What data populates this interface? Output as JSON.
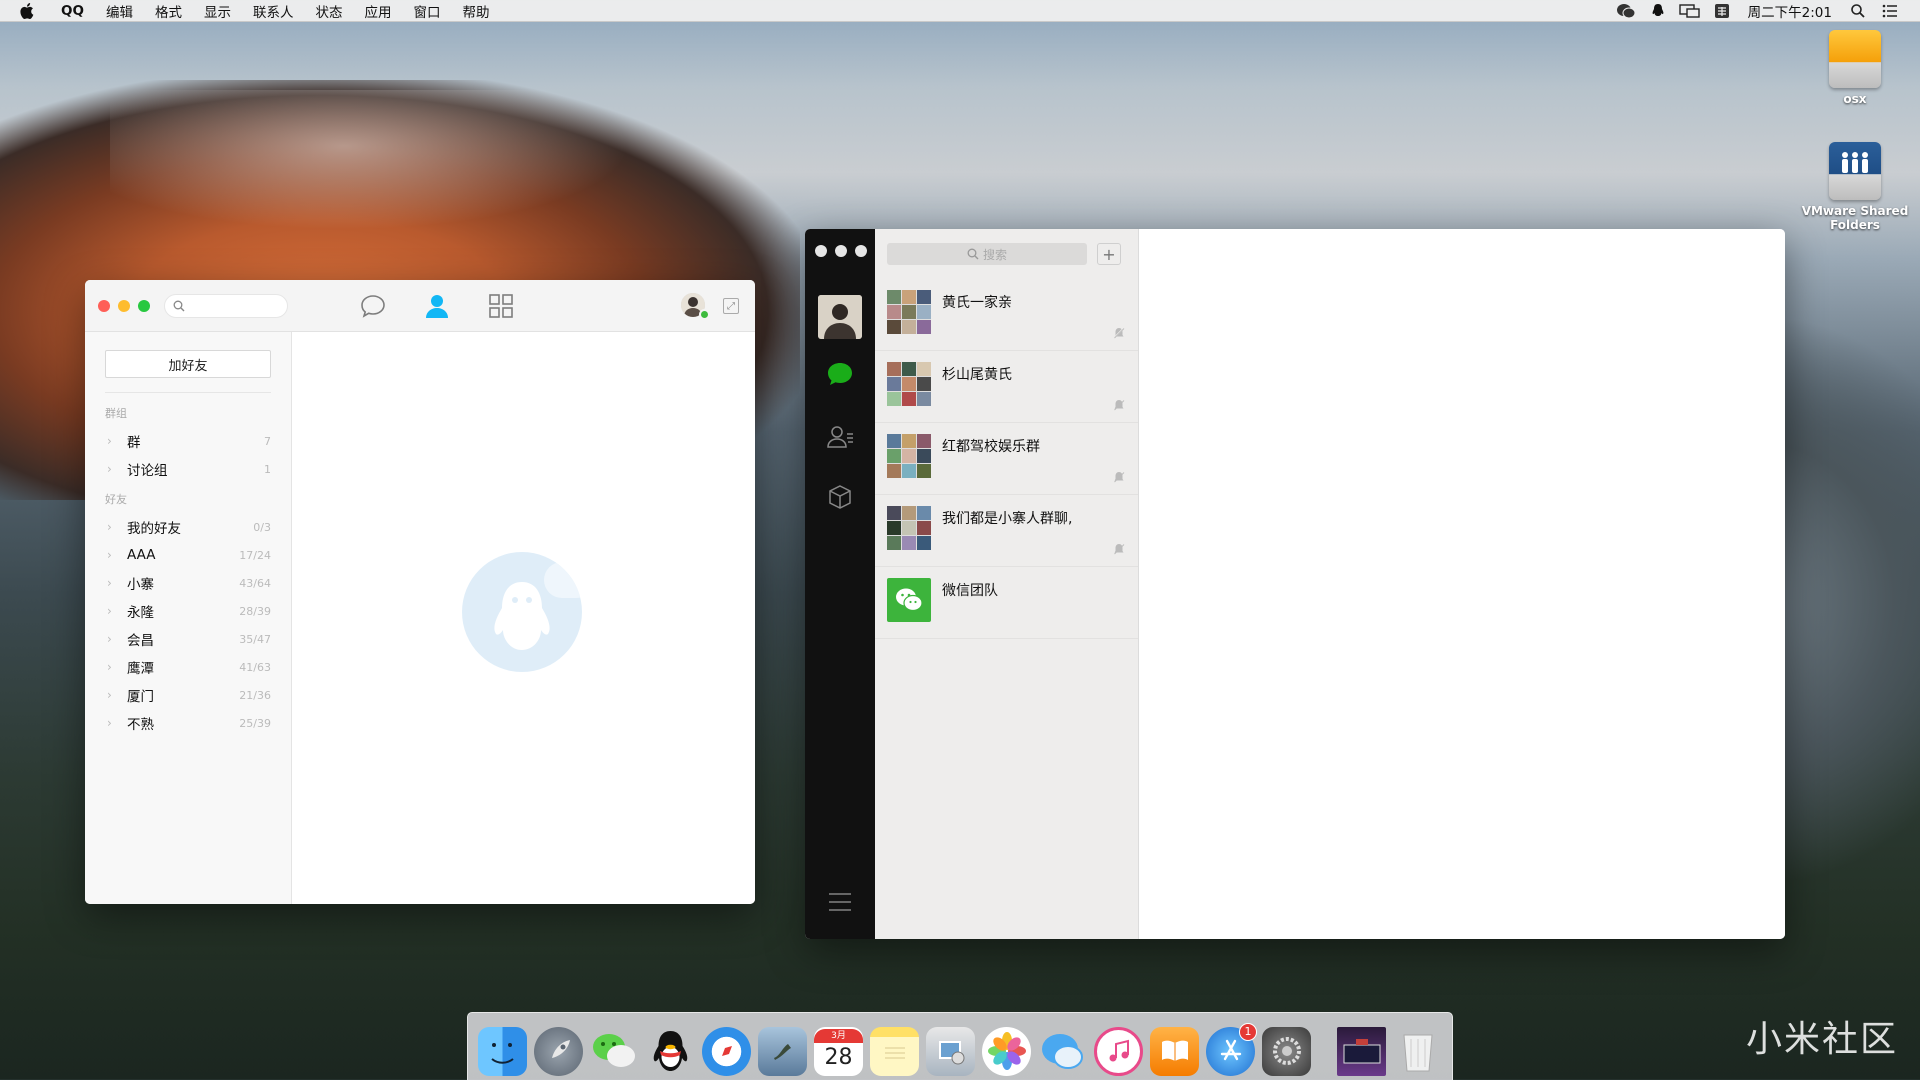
{
  "menubar": {
    "app_name": "QQ",
    "items": [
      "编辑",
      "格式",
      "显示",
      "联系人",
      "状态",
      "应用",
      "窗口",
      "帮助"
    ],
    "clock": "周二下午2:01"
  },
  "desktop": {
    "icons": [
      {
        "label": "osx"
      },
      {
        "label": "VMware Shared Folders"
      }
    ]
  },
  "qq": {
    "search_placeholder": "",
    "add_friend": "加好友",
    "section_groups": "群组",
    "groups": [
      {
        "name": "群",
        "count": "7"
      },
      {
        "name": "讨论组",
        "count": "1"
      }
    ],
    "section_friends": "好友",
    "friends": [
      {
        "name": "我的好友",
        "count": "0/3"
      },
      {
        "name": "AAA",
        "count": "17/24"
      },
      {
        "name": "小寨",
        "count": "43/64"
      },
      {
        "name": "永隆",
        "count": "28/39"
      },
      {
        "name": "会昌",
        "count": "35/47"
      },
      {
        "name": "鹰潭",
        "count": "41/63"
      },
      {
        "name": "厦门",
        "count": "21/36"
      },
      {
        "name": "不熟",
        "count": "25/39"
      }
    ]
  },
  "wechat": {
    "search_placeholder": "搜索",
    "chats": [
      {
        "name": "黄氏一家亲",
        "muted": true
      },
      {
        "name": "杉山尾黄氏",
        "muted": true
      },
      {
        "name": "红都驾校娱乐群",
        "muted": true
      },
      {
        "name": "我们都是小寨人群聊,",
        "muted": true
      },
      {
        "name": "微信团队",
        "muted": false
      }
    ]
  },
  "dock": {
    "calendar_month": "3月",
    "calendar_day": "28",
    "appstore_badge": "1"
  },
  "watermark": "小米社区",
  "colors": {
    "wechat_green": "#1aad19",
    "qq_blue": "#12b7f5",
    "traffic_red": "#fe5f57",
    "traffic_yellow": "#febc2e",
    "traffic_green": "#28c840"
  }
}
